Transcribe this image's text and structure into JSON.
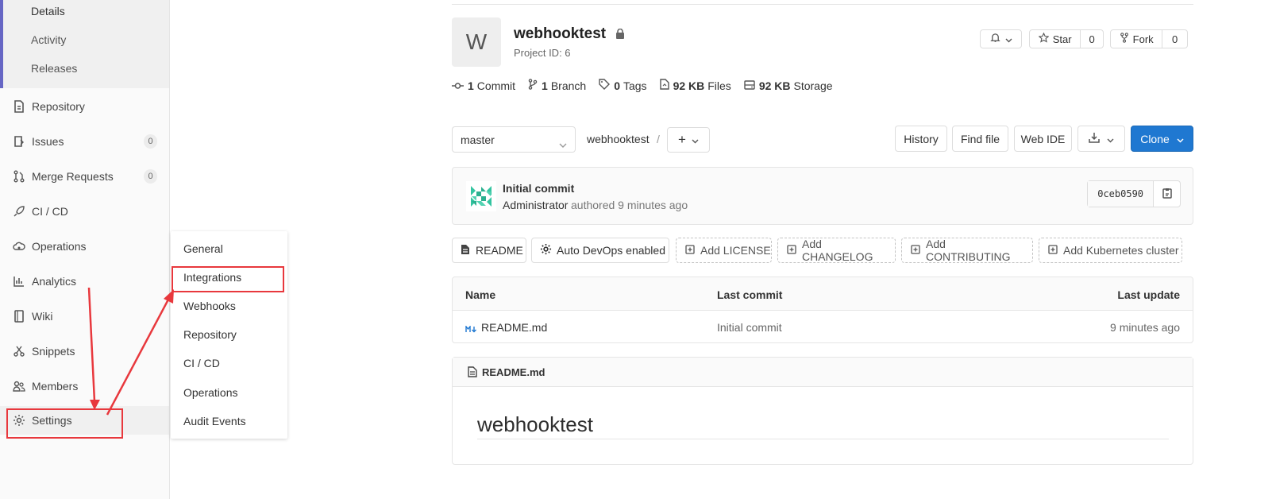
{
  "sidebar": {
    "sub_items": [
      "Details",
      "Activity",
      "Releases"
    ],
    "items": [
      {
        "label": "Repository",
        "icon": "document-icon"
      },
      {
        "label": "Issues",
        "icon": "issues-icon",
        "badge": "0"
      },
      {
        "label": "Merge Requests",
        "icon": "merge-request-icon",
        "badge": "0"
      },
      {
        "label": "CI / CD",
        "icon": "rocket-icon"
      },
      {
        "label": "Operations",
        "icon": "cloud-gear-icon"
      },
      {
        "label": "Analytics",
        "icon": "chart-icon"
      },
      {
        "label": "Wiki",
        "icon": "book-icon"
      },
      {
        "label": "Snippets",
        "icon": "scissors-icon"
      },
      {
        "label": "Members",
        "icon": "members-icon"
      },
      {
        "label": "Settings",
        "icon": "gear-icon"
      }
    ]
  },
  "flyout": {
    "items": [
      "General",
      "Integrations",
      "Webhooks",
      "Repository",
      "CI / CD",
      "Operations",
      "Audit Events"
    ]
  },
  "project": {
    "avatar_letter": "W",
    "title": "webhooktest",
    "id_text": "Project ID: 6",
    "star_label": "Star",
    "star_count": "0",
    "fork_label": "Fork",
    "fork_count": "0"
  },
  "stats": [
    {
      "value": "1",
      "label": "Commit",
      "icon": "commit-icon"
    },
    {
      "value": "1",
      "label": "Branch",
      "icon": "branch-icon"
    },
    {
      "value": "0",
      "label": "Tags",
      "icon": "tag-icon"
    },
    {
      "value": "92 KB",
      "label": "Files",
      "icon": "files-icon"
    },
    {
      "value": "92 KB",
      "label": "Storage",
      "icon": "storage-icon"
    }
  ],
  "toolbar": {
    "branch": "master",
    "path": "webhooktest",
    "separator": "/",
    "plus": "+",
    "history": "History",
    "find_file": "Find file",
    "web_ide": "Web IDE",
    "clone": "Clone"
  },
  "commit": {
    "title": "Initial commit",
    "author": "Administrator",
    "meta": "authored 9 minutes ago",
    "sha": "0ceb0590"
  },
  "actions": {
    "readme": "README",
    "auto_devops": "Auto DevOps enabled",
    "add_license": "Add LICENSE",
    "add_changelog": "Add CHANGELOG",
    "add_contributing": "Add CONTRIBUTING",
    "add_k8s": "Add Kubernetes cluster"
  },
  "table": {
    "headers": {
      "name": "Name",
      "last_commit": "Last commit",
      "last_update": "Last update"
    },
    "rows": [
      {
        "name": "README.md",
        "last_commit": "Initial commit",
        "last_update": "9 minutes ago"
      }
    ]
  },
  "readme": {
    "filename": "README.md",
    "heading": "webhooktest"
  },
  "colors": {
    "accent_blue": "#1f78d1",
    "annotation_red": "#e8383d",
    "sidebar_active_border": "#6666c4"
  }
}
